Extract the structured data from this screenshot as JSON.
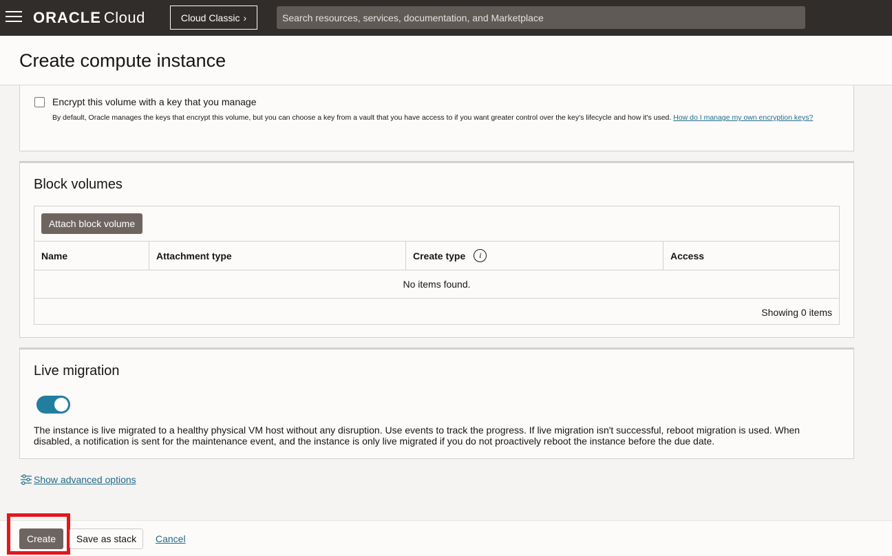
{
  "topbar": {
    "brand": "ORACLE",
    "product": "Cloud",
    "classic_label": "Cloud Classic",
    "search_placeholder": "Search resources, services, documentation, and Marketplace"
  },
  "page": {
    "title": "Create compute instance"
  },
  "encryption": {
    "checkbox_label": "Encrypt this volume with a key that you manage",
    "checked": false,
    "help_text": "By default, Oracle manages the keys that encrypt this volume, but you can choose a key from a vault that you have access to if you want greater control over the key's lifecycle and how it's used.",
    "help_link": "How do I manage my own encryption keys?"
  },
  "block_volumes": {
    "title": "Block volumes",
    "attach_button": "Attach block volume",
    "columns": [
      "Name",
      "Attachment type",
      "Create type",
      "Access"
    ],
    "empty_text": "No items found.",
    "showing_text": "Showing 0 items"
  },
  "live_migration": {
    "title": "Live migration",
    "enabled": true,
    "description": "The instance is live migrated to a healthy physical VM host without any disruption. Use events to track the progress. If live migration isn't successful, reboot migration is used. When disabled, a notification is sent for the maintenance event, and the instance is only live migrated if you do not proactively reboot the instance before the due date."
  },
  "advanced": {
    "link_label": "Show advanced options"
  },
  "footer": {
    "create_label": "Create",
    "save_stack_label": "Save as stack",
    "cancel_label": "Cancel"
  },
  "colors": {
    "topbar": "#312d2a",
    "primary_button": "#6f6560",
    "toggle_on": "#227e9e",
    "link": "#1f6b8a",
    "highlight": "#e4161b"
  }
}
